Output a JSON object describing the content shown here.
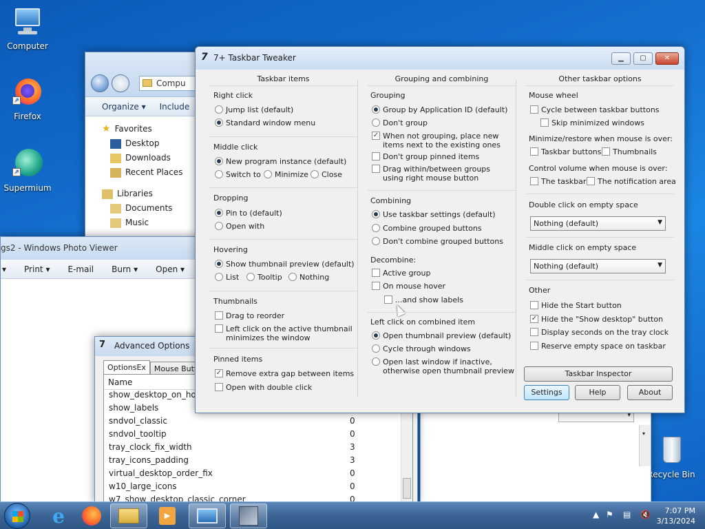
{
  "desktop": {
    "icons": [
      {
        "label": "Computer"
      },
      {
        "label": "Firefox"
      },
      {
        "label": "Supermium"
      },
      {
        "label": "Recycle Bin"
      }
    ]
  },
  "explorer": {
    "address": "Compu",
    "toolbar": {
      "organize": "Organize ▾",
      "include": "Include"
    },
    "nav": {
      "favorites": "Favorites",
      "desktop": "Desktop",
      "downloads": "Downloads",
      "recent": "Recent Places",
      "libraries": "Libraries",
      "documents": "Documents",
      "music": "Music"
    }
  },
  "photo_viewer": {
    "title": "gs2 - Windows Photo Viewer",
    "toolbar": {
      "print": "Print ▾",
      "email": "E-mail",
      "burn": "Burn ▾",
      "open": "Open ▾"
    }
  },
  "advanced": {
    "title": "Advanced Options",
    "tabs": [
      "OptionsEx",
      "Mouse Buttor"
    ],
    "column": "Name",
    "rows": [
      {
        "name": "show_desktop_on_hove",
        "value": ""
      },
      {
        "name": "show_labels",
        "value": ""
      },
      {
        "name": "sndvol_classic",
        "value": "0"
      },
      {
        "name": "sndvol_tooltip",
        "value": "0"
      },
      {
        "name": "tray_clock_fix_width",
        "value": "3"
      },
      {
        "name": "tray_icons_padding",
        "value": "3"
      },
      {
        "name": "virtual_desktop_order_fix",
        "value": "0"
      },
      {
        "name": "w10_large_icons",
        "value": "0"
      },
      {
        "name": "w7_show_desktop_classic_corner",
        "value": "0"
      }
    ]
  },
  "tweaker": {
    "title": "7+ Taskbar Tweaker",
    "caption": {
      "min": "▁",
      "max": "▢",
      "close": "✕"
    },
    "col1": {
      "header": "Taskbar items",
      "right_click": {
        "label": "Right click",
        "opt1": "Jump list (default)",
        "opt2": "Standard window menu"
      },
      "middle_click": {
        "label": "Middle click",
        "opt1": "New program instance (default)",
        "opt2": "Switch to",
        "opt3": "Minimize",
        "opt4": "Close"
      },
      "dropping": {
        "label": "Dropping",
        "opt1": "Pin to (default)",
        "opt2": "Open with"
      },
      "hovering": {
        "label": "Hovering",
        "opt1": "Show thumbnail preview (default)",
        "opt2": "List",
        "opt3": "Tooltip",
        "opt4": "Nothing"
      },
      "thumbnails": {
        "label": "Thumbnails",
        "opt1": "Drag to reorder",
        "opt2a": "Left click on the active thumbnail",
        "opt2b": "minimizes the window"
      },
      "pinned": {
        "label": "Pinned items",
        "opt1": "Remove extra gap between items",
        "opt2": "Open with double click"
      }
    },
    "col2": {
      "header": "Grouping and combining",
      "grouping": {
        "label": "Grouping",
        "opt1": "Group by Application ID (default)",
        "opt2": "Don't group",
        "opt3a": "When not grouping, place new",
        "opt3b": "items next to the existing ones",
        "opt4": "Don't group pinned items",
        "opt5a": "Drag within/between groups",
        "opt5b": "using right mouse button"
      },
      "combining": {
        "label": "Combining",
        "opt1": "Use taskbar settings (default)",
        "opt2": "Combine grouped buttons",
        "opt3": "Don't combine grouped buttons"
      },
      "decombine": {
        "label": "Decombine:",
        "opt1": "Active group",
        "opt2": "On mouse hover",
        "opt3": "...and show labels"
      },
      "leftclick": {
        "label": "Left click on combined item",
        "opt1": "Open thumbnail preview (default)",
        "opt2": "Cycle through windows",
        "opt3a": "Open last window if inactive,",
        "opt3b": "otherwise open thumbnail preview"
      }
    },
    "col3": {
      "header": "Other taskbar options",
      "wheel": {
        "label": "Mouse wheel",
        "opt1": "Cycle between taskbar buttons",
        "opt2": "Skip minimized windows"
      },
      "minrestore": {
        "label": "Minimize/restore when mouse is over:",
        "opt1": "Taskbar buttons",
        "opt2": "Thumbnails"
      },
      "volume": {
        "label": "Control volume when mouse is over:",
        "opt1": "The taskbar",
        "opt2": "The notification area"
      },
      "dblclick": {
        "label": "Double click on empty space",
        "value": "Nothing (default)"
      },
      "midclick": {
        "label": "Middle click on empty space",
        "value": "Nothing (default)"
      },
      "other": {
        "label": "Other",
        "opt1": "Hide the Start button",
        "opt2": "Hide the \"Show desktop\" button",
        "opt3": "Display seconds on the tray clock",
        "opt4": "Reserve empty space on taskbar"
      },
      "inspector": "Taskbar Inspector"
    },
    "buttons": {
      "settings": "Settings",
      "help": "Help",
      "about": "About"
    }
  },
  "taskbar": {
    "time": "7:07 PM",
    "date": "3/13/2024"
  },
  "colors": {
    "accent": "#1470cf",
    "window_bg": "#f0f0f0"
  }
}
